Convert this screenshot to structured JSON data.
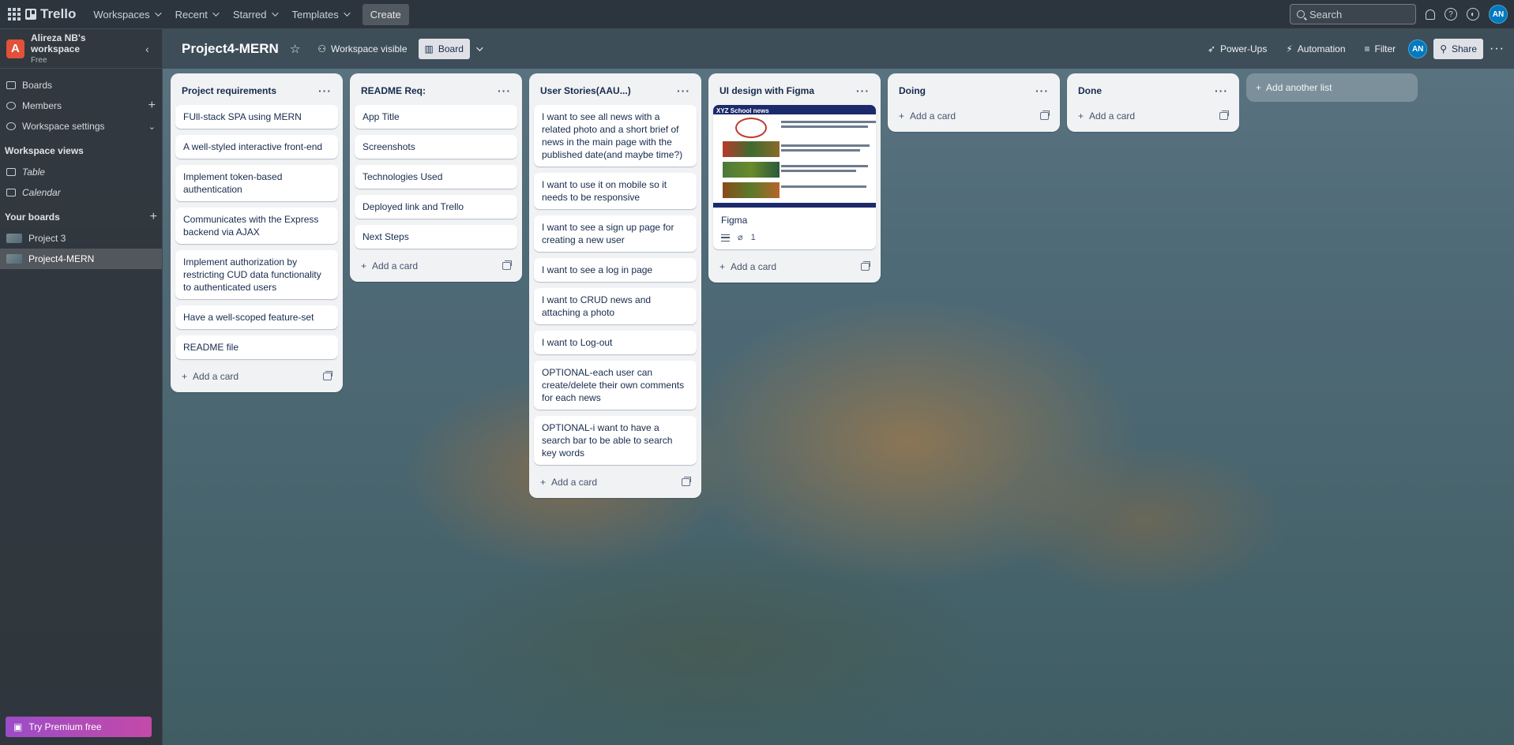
{
  "topbar": {
    "brand": "Trello",
    "nav": [
      "Workspaces",
      "Recent",
      "Starred",
      "Templates"
    ],
    "create_label": "Create",
    "search_placeholder": "Search",
    "avatar_initials": "AN"
  },
  "sidebar": {
    "workspace_initial": "A",
    "workspace_name": "Alireza NB's workspace",
    "workspace_plan": "Free",
    "boards_label": "Boards",
    "members_label": "Members",
    "settings_label": "Workspace settings",
    "views_heading": "Workspace views",
    "table_label": "Table",
    "calendar_label": "Calendar",
    "your_boards_heading": "Your boards",
    "boards": [
      "Project 3",
      "Project4-MERN"
    ],
    "premium_label": "Try Premium free"
  },
  "board": {
    "title": "Project4-MERN",
    "visibility_label": "Workspace visible",
    "view_label": "Board",
    "powerups_label": "Power-Ups",
    "automation_label": "Automation",
    "filter_label": "Filter",
    "share_label": "Share",
    "add_card_label": "Add a card",
    "add_list_label": "Add another list"
  },
  "lists": [
    {
      "title": "Project requirements",
      "cards": [
        "FUll-stack SPA using MERN",
        "A well-styled interactive front-end",
        "Implement token-based authentication",
        "Communicates with the Express backend via AJAX",
        "Implement authorization by restricting CUD data functionality to authenticated users",
        "Have a well-scoped feature-set",
        "README file"
      ]
    },
    {
      "title": "README Req:",
      "cards": [
        "App Title",
        "Screenshots",
        "Technologies Used",
        "Deployed link and Trello",
        "Next Steps"
      ]
    },
    {
      "title": "User Stories(AAU...)",
      "cards": [
        "I want to see all news with a related photo and a short brief of news in the main page with the published date(and maybe time?)",
        "I want to use it on mobile so it needs to be responsive",
        "I want to see a sign up page for creating a new user",
        "I want to see a log in page",
        "I want to CRUD news and attaching a photo",
        "I want to Log-out",
        "OPTIONAL-each user can create/delete their own comments for each news",
        "OPTIONAL-i want to have a search bar to be able to search key words"
      ]
    },
    {
      "title": "UI design with Figma",
      "cover_title": "XYZ School news",
      "card_title": "Figma",
      "attachments": "1"
    },
    {
      "title": "Doing",
      "cards": []
    },
    {
      "title": "Done",
      "cards": []
    }
  ]
}
